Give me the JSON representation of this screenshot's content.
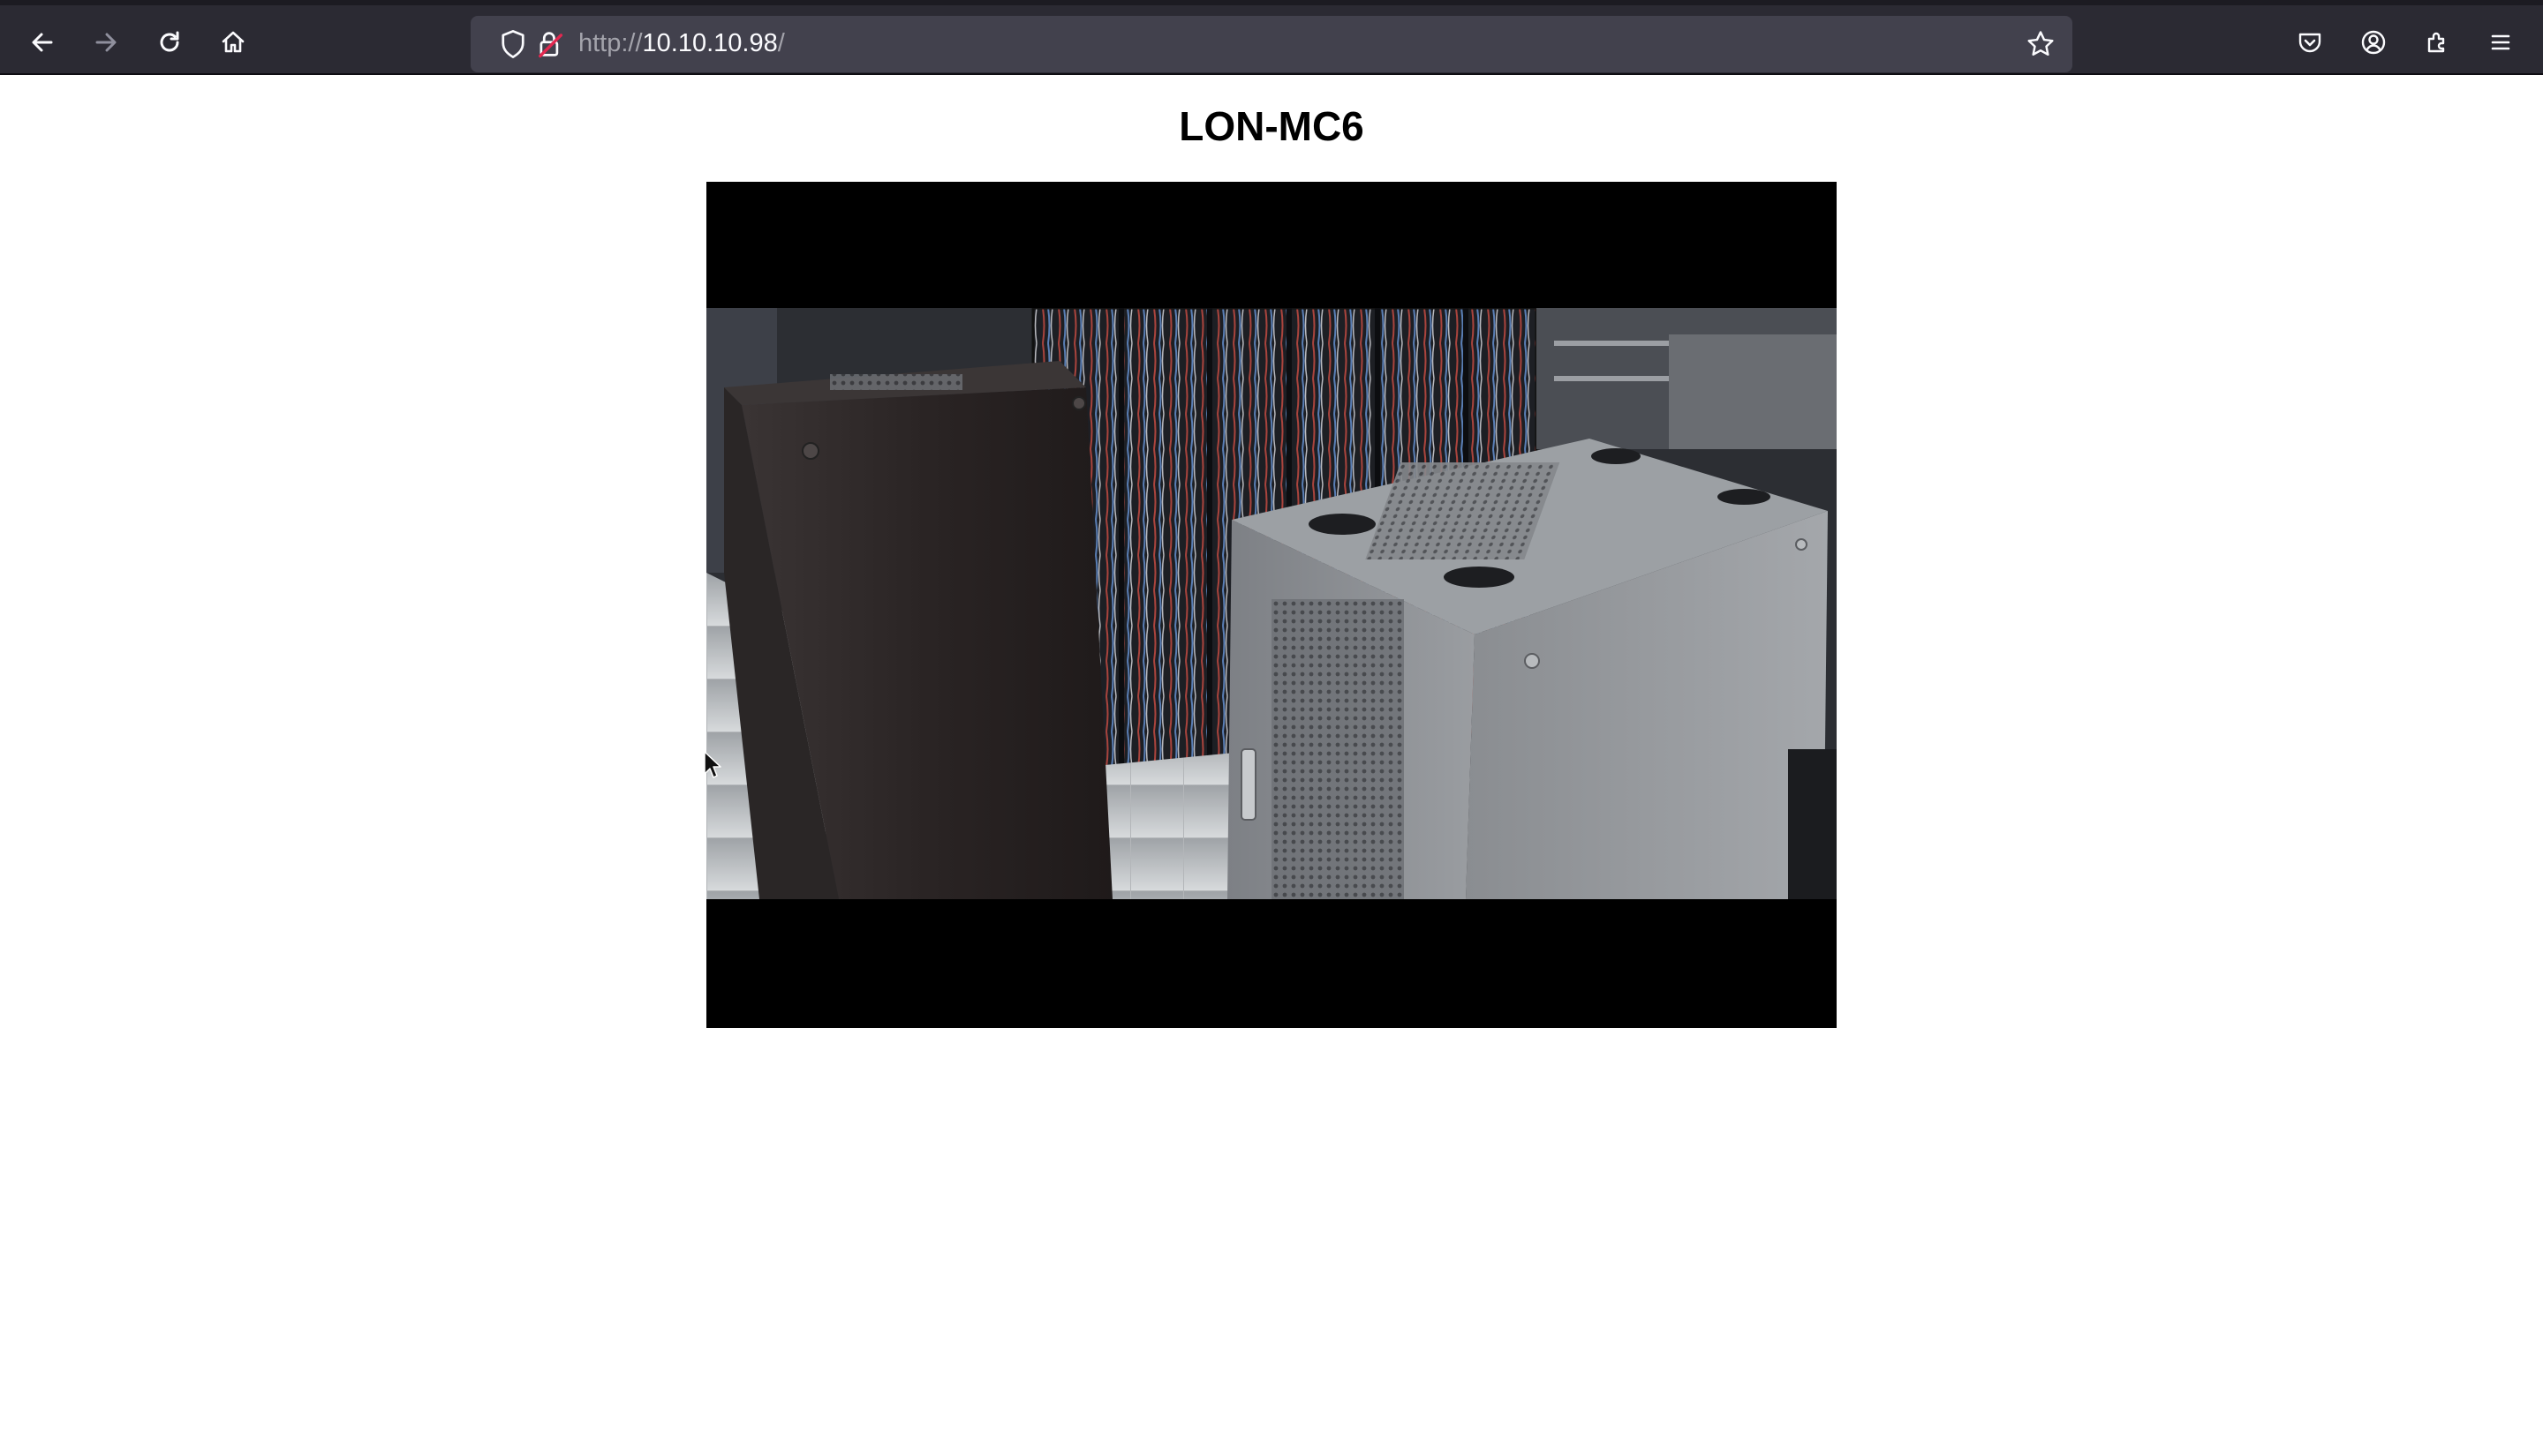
{
  "browser": {
    "url_scheme": "http://",
    "url_host": "10.10.10.98",
    "url_path": "/",
    "icons": {
      "back": "back-arrow-icon",
      "forward": "forward-arrow-icon",
      "reload": "reload-icon",
      "home": "home-icon",
      "tracking": "shield-icon",
      "security": "lock-icon",
      "bookmark": "star-icon",
      "pocket": "pocket-icon",
      "account": "account-icon",
      "extensions": "extensions-icon",
      "menu": "hamburger-menu-icon"
    }
  },
  "page": {
    "title": "LON-MC6"
  },
  "camera": {
    "description_icon": "camera-feed-image"
  },
  "colors": {
    "toolbar_bg": "#2b2a33",
    "urlbar_bg": "#42414d",
    "page_bg": "#ffffff",
    "frame_bg": "#000000"
  }
}
